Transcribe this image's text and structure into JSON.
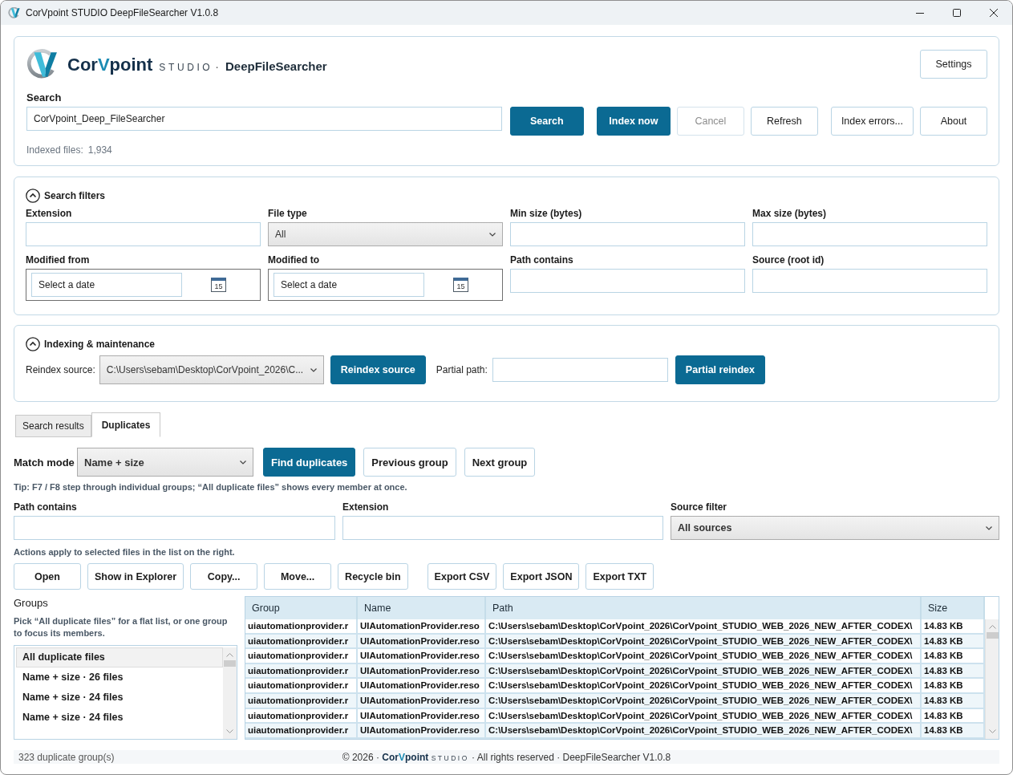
{
  "window": {
    "title": "CorVpoint STUDIO DeepFileSearcher V1.0.8"
  },
  "header": {
    "brand": {
      "name": [
        "Cor",
        "V",
        "point"
      ],
      "studio": "STUDIO",
      "separator": "·",
      "product": "DeepFileSearcher"
    },
    "settings_button": "Settings",
    "search": {
      "label": "Search",
      "value": "CorVpoint_Deep_FileSearcher"
    },
    "button_groups": [
      [
        {
          "label": "Search",
          "kind": "primary",
          "disabled": false
        }
      ],
      [
        {
          "label": "Index now",
          "kind": "primary",
          "disabled": false
        },
        {
          "label": "Cancel",
          "kind": "secondary",
          "disabled": true
        },
        {
          "label": "Refresh",
          "kind": "secondary",
          "disabled": false
        }
      ],
      [
        {
          "label": "Index errors...",
          "kind": "secondary",
          "disabled": false
        },
        {
          "label": "About",
          "kind": "secondary",
          "disabled": false
        }
      ]
    ],
    "indexed_files": {
      "label": "Indexed files:",
      "value": "1,934"
    }
  },
  "filters": {
    "title": "Search filters",
    "expanded": true,
    "fields": [
      {
        "label": "Extension",
        "kind": "text"
      },
      {
        "label": "File type",
        "kind": "select",
        "value": "All"
      },
      {
        "label": "Min size (bytes)",
        "kind": "text"
      },
      {
        "label": "Max size (bytes)",
        "kind": "text"
      },
      {
        "label": "Modified from",
        "kind": "date",
        "placeholder": "Select a date",
        "calendar_label": "15"
      },
      {
        "label": "Modified to",
        "kind": "date",
        "placeholder": "Select a date",
        "calendar_label": "15"
      },
      {
        "label": "Path contains",
        "kind": "text"
      },
      {
        "label": "Source (root id)",
        "kind": "text"
      }
    ]
  },
  "indexing": {
    "title": "Indexing & maintenance",
    "expanded": true,
    "source": {
      "label": "Reindex source:",
      "value": "C:\\Users\\sebam\\Desktop\\CorVpoint_2026\\C..."
    },
    "reindex_button": "Reindex source",
    "partial_label": "Partial path:",
    "partial_button": "Partial reindex"
  },
  "tabs": [
    {
      "label": "Search results",
      "selected": false
    },
    {
      "label": "Duplicates",
      "selected": true
    }
  ],
  "duplicates": {
    "match_mode": {
      "label": "Match mode",
      "value": "Name + size"
    },
    "buttons": [
      {
        "label": "Find duplicates",
        "kind": "primary"
      },
      {
        "label": "Previous group",
        "kind": "secondary"
      },
      {
        "label": "Next group",
        "kind": "secondary"
      }
    ],
    "tip": "Tip: F7 / F8 step through individual groups; “All duplicate files” shows every member at once.",
    "filters": [
      {
        "label": "Path contains",
        "kind": "text"
      },
      {
        "label": "Extension",
        "kind": "text"
      },
      {
        "label": "Source filter",
        "kind": "select",
        "value": "All sources"
      }
    ],
    "actions_hint": "Actions apply to selected files in the list on the right.",
    "action_groups": [
      [
        "Open",
        "Show in Explorer",
        "Copy...",
        "Move...",
        "Recycle bin"
      ],
      [
        "Export CSV",
        "Export JSON",
        "Export TXT"
      ]
    ],
    "groups": {
      "title": "Groups",
      "hint": "Pick “All duplicate files” for a flat list, or one group to focus its members.",
      "items": [
        {
          "label": "All duplicate files",
          "selected": true
        },
        {
          "label": "Name + size · 26 files",
          "selected": false
        },
        {
          "label": "Name + size · 24 files",
          "selected": false
        },
        {
          "label": "Name + size · 24 files",
          "selected": false
        }
      ]
    },
    "table": {
      "columns": [
        "Group",
        "Name",
        "Path",
        "Size"
      ],
      "rows": [
        [
          "uiautomationprovider.r",
          "UIAutomationProvider.reso",
          "C:\\Users\\sebam\\Desktop\\CorVpoint_2026\\CorVpoint_STUDIO_WEB_2026_NEW_AFTER_CODEX\\",
          "14.83 KB"
        ],
        [
          "uiautomationprovider.r",
          "UIAutomationProvider.reso",
          "C:\\Users\\sebam\\Desktop\\CorVpoint_2026\\CorVpoint_STUDIO_WEB_2026_NEW_AFTER_CODEX\\",
          "14.83 KB"
        ],
        [
          "uiautomationprovider.r",
          "UIAutomationProvider.reso",
          "C:\\Users\\sebam\\Desktop\\CorVpoint_2026\\CorVpoint_STUDIO_WEB_2026_NEW_AFTER_CODEX\\",
          "14.83 KB"
        ],
        [
          "uiautomationprovider.r",
          "UIAutomationProvider.reso",
          "C:\\Users\\sebam\\Desktop\\CorVpoint_2026\\CorVpoint_STUDIO_WEB_2026_NEW_AFTER_CODEX\\",
          "14.83 KB"
        ],
        [
          "uiautomationprovider.r",
          "UIAutomationProvider.reso",
          "C:\\Users\\sebam\\Desktop\\CorVpoint_2026\\CorVpoint_STUDIO_WEB_2026_NEW_AFTER_CODEX\\",
          "14.83 KB"
        ],
        [
          "uiautomationprovider.r",
          "UIAutomationProvider.reso",
          "C:\\Users\\sebam\\Desktop\\CorVpoint_2026\\CorVpoint_STUDIO_WEB_2026_NEW_AFTER_CODEX\\",
          "14.83 KB"
        ],
        [
          "uiautomationprovider.r",
          "UIAutomationProvider.reso",
          "C:\\Users\\sebam\\Desktop\\CorVpoint_2026\\CorVpoint_STUDIO_WEB_2026_NEW_AFTER_CODEX\\",
          "14.83 KB"
        ],
        [
          "uiautomationprovider.r",
          "UIAutomationProvider.reso",
          "C:\\Users\\sebam\\Desktop\\CorVpoint_2026\\CorVpoint_STUDIO_WEB_2026_NEW_AFTER_CODEX\\",
          "14.83 KB"
        ]
      ]
    }
  },
  "status_bar": {
    "text": "323 duplicate group(s)",
    "copyright": {
      "prefix": "© 2026 ·",
      "brand": [
        "Cor",
        "V",
        "point"
      ],
      "studio": "STUDIO",
      "suffix": "· All rights reserved · DeepFileSearcher V1.0.8"
    }
  }
}
